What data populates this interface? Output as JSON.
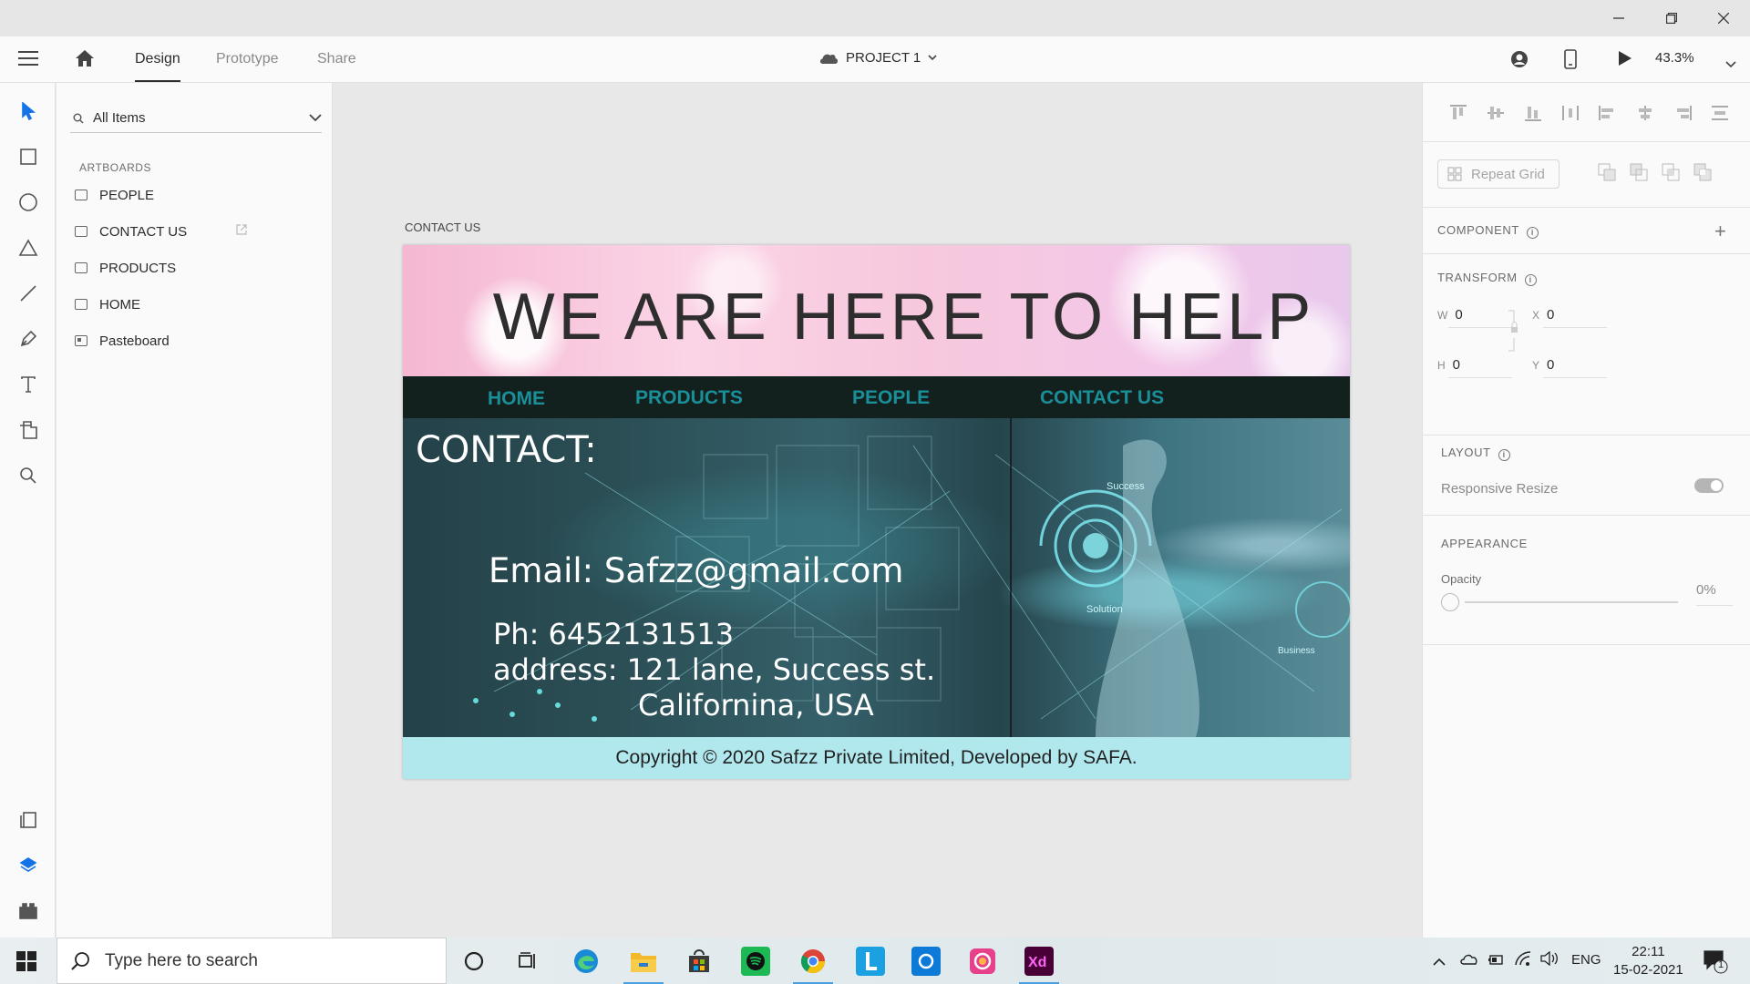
{
  "window": {
    "minimize_icon": "minimize-icon",
    "maximize_icon": "restore-icon",
    "close_icon": "close-icon"
  },
  "header": {
    "tabs": [
      {
        "label": "Design",
        "active": true
      },
      {
        "label": "Prototype",
        "active": false
      },
      {
        "label": "Share",
        "active": false
      }
    ],
    "document_title": "PROJECT 1",
    "zoom": "43.3%"
  },
  "layers": {
    "search_value": "All Items",
    "section_label": "ARTBOARDS",
    "items": [
      {
        "label": "PEOPLE"
      },
      {
        "label": "CONTACT US"
      },
      {
        "label": "PRODUCTS"
      },
      {
        "label": "HOME"
      },
      {
        "label": "Pasteboard"
      }
    ]
  },
  "canvas": {
    "artboard_label": "CONTACT US",
    "artboard": {
      "hero_title": "WE ARE HERE TO HELP",
      "nav": [
        "HOME",
        "PRODUCTS",
        "PEOPLE",
        "CONTACT US"
      ],
      "contact_heading": "CONTACT:",
      "email": "Email: Safzz@gmail.com",
      "phone": "Ph: 6452131513",
      "address_line1": "address: 121 lane, Success st.",
      "address_line2": "Californina, USA",
      "image_labels": {
        "success": "Success",
        "solution": "Solution",
        "business": "Business"
      },
      "footer": "Copyright © 2020 Safzz Private Limited, Developed by SAFA."
    }
  },
  "props": {
    "repeat_grid": "Repeat Grid",
    "component_label": "COMPONENT",
    "transform_label": "TRANSFORM",
    "w_key": "W",
    "w": "0",
    "h_key": "H",
    "h": "0",
    "x_key": "X",
    "x": "0",
    "y_key": "Y",
    "y": "0",
    "layout_label": "LAYOUT",
    "responsive_resize": "Responsive Resize",
    "appearance_label": "APPEARANCE",
    "opacity_label": "Opacity",
    "opacity_value": "0%"
  },
  "taskbar": {
    "search_placeholder": "Type here to search",
    "language": "ENG",
    "time": "22:11",
    "date": "15-02-2021",
    "notifications": "1"
  }
}
